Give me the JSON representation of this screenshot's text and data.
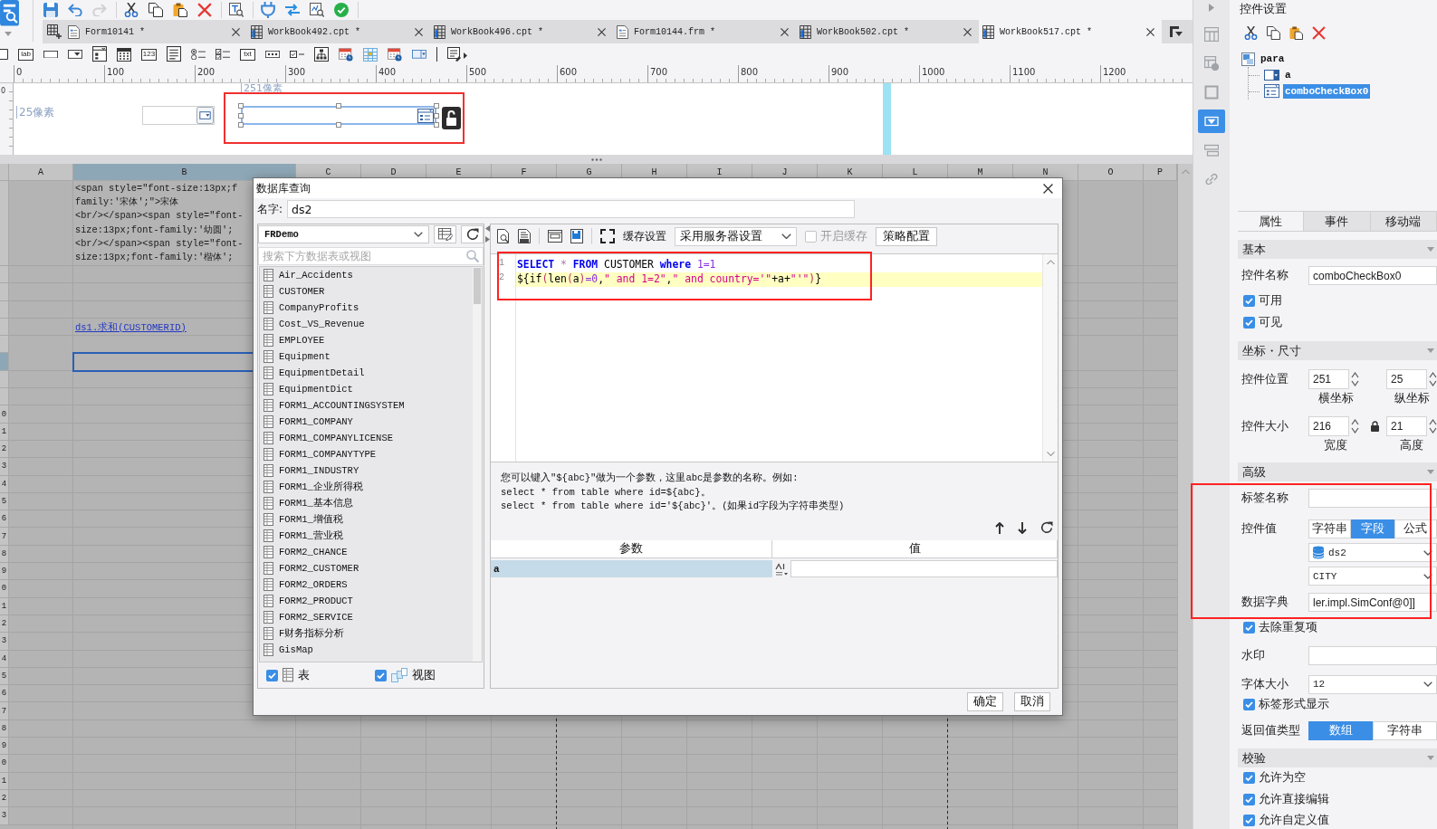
{
  "toolbar": {
    "groups": [
      [
        {
          "kind": "save",
          "disabled": false
        },
        {
          "kind": "undo",
          "disabled": false
        },
        {
          "kind": "redo",
          "disabled": true
        }
      ],
      [
        {
          "kind": "cut",
          "disabled": false
        },
        {
          "kind": "copy",
          "disabled": false
        },
        {
          "kind": "paste",
          "disabled": false
        },
        {
          "kind": "delete",
          "disabled": false
        }
      ],
      [
        {
          "kind": "find",
          "disabled": false
        }
      ],
      [
        {
          "kind": "connect",
          "disabled": false
        },
        {
          "kind": "swap",
          "disabled": false
        },
        {
          "kind": "inspect",
          "disabled": false
        },
        {
          "kind": "verify",
          "disabled": false
        }
      ]
    ]
  },
  "doc_tabs": [
    {
      "kind": "form",
      "label": "Form10141 *",
      "selected": false
    },
    {
      "kind": "workbook",
      "label": "WorkBook492.cpt *",
      "selected": false
    },
    {
      "kind": "workbook",
      "label": "WorkBook496.cpt *",
      "selected": false
    },
    {
      "kind": "form",
      "label": "Form10144.frm *",
      "selected": false
    },
    {
      "kind": "workbook",
      "label": "WorkBook502.cpt *",
      "selected": false
    },
    {
      "kind": "workbook",
      "label": "WorkBook517.cpt *",
      "selected": true
    }
  ],
  "widget_bar": [
    {
      "kind": "frame"
    },
    {
      "kind": "label",
      "caption": "lab"
    },
    {
      "kind": "button"
    },
    {
      "kind": "combo"
    },
    {
      "kind": "window"
    },
    {
      "kind": "calendar"
    },
    {
      "kind": "number",
      "caption": "123"
    },
    {
      "kind": "textarea"
    },
    {
      "kind": "radio"
    },
    {
      "kind": "checklist"
    },
    {
      "kind": "textbox",
      "caption": "txt"
    },
    {
      "kind": "password"
    },
    {
      "kind": "checkbox"
    },
    {
      "kind": "tree"
    },
    {
      "kind": "date"
    },
    {
      "kind": "grid"
    },
    {
      "kind": "date"
    },
    {
      "kind": "combocheck"
    },
    {
      "kind": "divider"
    },
    {
      "kind": "more"
    }
  ],
  "ruler": {
    "labels": [
      "0",
      "100",
      "200",
      "300",
      "400",
      "500",
      "600",
      "700",
      "800",
      "900",
      "1000",
      "1100",
      "1200"
    ],
    "side_label": "0"
  },
  "designer": {
    "left_guide": "25像素",
    "top_guide": "251像素",
    "selection_locked": false,
    "widgets": [
      {
        "kind": "combo",
        "selected": false,
        "highlighted": false
      },
      {
        "kind": "combocheck",
        "selected": true,
        "highlighted": true
      }
    ]
  },
  "sheet": {
    "columns": [
      {
        "label": "A",
        "selected": false,
        "page_break": false
      },
      {
        "label": "B",
        "selected": true,
        "page_break": false
      },
      {
        "label": "C",
        "selected": false,
        "page_break": false
      },
      {
        "label": "D",
        "selected": false,
        "page_break": false
      },
      {
        "label": "E",
        "selected": false,
        "page_break": false
      },
      {
        "label": "F",
        "selected": false,
        "page_break": true
      },
      {
        "label": "G",
        "selected": false,
        "page_break": false
      },
      {
        "label": "H",
        "selected": false,
        "page_break": false
      },
      {
        "label": "I",
        "selected": false,
        "page_break": false
      },
      {
        "label": "J",
        "selected": false,
        "page_break": false
      },
      {
        "label": "K",
        "selected": false,
        "page_break": false
      },
      {
        "label": "L",
        "selected": false,
        "page_break": true
      },
      {
        "label": "M",
        "selected": false,
        "page_break": false
      },
      {
        "label": "N",
        "selected": false,
        "page_break": false
      },
      {
        "label": "O",
        "selected": false,
        "page_break": false
      },
      {
        "label": "P",
        "selected": false,
        "page_break": false
      }
    ],
    "rows": [
      {
        "selected": false,
        "column_b": {
          "kind": "text",
          "lines": [
            "<span style=\"font-size:13px;f",
            "family:'宋体';\">宋体",
            "<br/></span><span style=\"font-",
            "size:13px;font-family:'幼圆';",
            "<br/></span><span style=\"font-",
            "size:13px;font-family:'楷体';"
          ]
        }
      },
      {
        "selected": false
      },
      {
        "selected": false
      },
      {
        "selected": false
      },
      {
        "selected": false,
        "column_b": {
          "kind": "link",
          "text": "ds1.求和(CUSTOMERID)"
        }
      },
      {
        "selected": false
      },
      {
        "selected": true
      },
      {
        "selected": false
      },
      {
        "selected": false
      },
      {
        "selected": false,
        "number": "0"
      },
      {
        "selected": false,
        "number": "1"
      },
      {
        "selected": false,
        "number": "2"
      },
      {
        "selected": false,
        "number": "3"
      },
      {
        "selected": false,
        "number": "4"
      },
      {
        "selected": false,
        "number": "5"
      },
      {
        "selected": false,
        "number": "6"
      },
      {
        "selected": false,
        "number": "7"
      },
      {
        "selected": false,
        "number": "8"
      },
      {
        "selected": false,
        "number": "9"
      },
      {
        "selected": false,
        "number": "0"
      },
      {
        "selected": false,
        "number": "1"
      },
      {
        "selected": false,
        "number": "2"
      },
      {
        "selected": false,
        "number": "3"
      },
      {
        "selected": false,
        "number": "4"
      },
      {
        "selected": false,
        "number": "5"
      },
      {
        "selected": false,
        "number": "6"
      },
      {
        "selected": false,
        "number": "7"
      },
      {
        "selected": false,
        "number": "8"
      },
      {
        "selected": false,
        "number": "9"
      },
      {
        "selected": false,
        "number": "0"
      },
      {
        "selected": false,
        "number": "1"
      },
      {
        "selected": false,
        "number": "2"
      },
      {
        "selected": false,
        "number": "3"
      }
    ]
  },
  "dialog": {
    "title": "数据库查询",
    "name_label": "名字:",
    "name_value": "ds2",
    "datasource": "FRDemo",
    "search_placeholder": "搜索下方数据表或视图",
    "tables": [
      {
        "label": "Air_Accidents",
        "selected": false
      },
      {
        "label": "CUSTOMER",
        "selected": false
      },
      {
        "label": "CompanyProfits",
        "selected": false
      },
      {
        "label": "Cost_VS_Revenue",
        "selected": false
      },
      {
        "label": "EMPLOYEE",
        "selected": false
      },
      {
        "label": "Equipment",
        "selected": false
      },
      {
        "label": "EquipmentDetail",
        "selected": false
      },
      {
        "label": "EquipmentDict",
        "selected": false
      },
      {
        "label": "FORM1_ACCOUNTINGSYSTEM",
        "selected": false
      },
      {
        "label": "FORM1_COMPANY",
        "selected": false
      },
      {
        "label": "FORM1_COMPANYLICENSE",
        "selected": false
      },
      {
        "label": "FORM1_COMPANYTYPE",
        "selected": false
      },
      {
        "label": "FORM1_INDUSTRY",
        "selected": false
      },
      {
        "label": "FORM1_企业所得税",
        "selected": false
      },
      {
        "label": "FORM1_基本信息",
        "selected": false
      },
      {
        "label": "FORM1_增值税",
        "selected": false
      },
      {
        "label": "FORM1_营业税",
        "selected": false
      },
      {
        "label": "FORM2_CHANCE",
        "selected": false
      },
      {
        "label": "FORM2_CUSTOMER",
        "selected": false
      },
      {
        "label": "FORM2_ORDERS",
        "selected": false
      },
      {
        "label": "FORM2_PRODUCT",
        "selected": false
      },
      {
        "label": "FORM2_SERVICE",
        "selected": false
      },
      {
        "label": "F财务指标分析",
        "selected": false
      },
      {
        "label": "GisMap",
        "selected": false
      }
    ],
    "filters": [
      {
        "kind": "table",
        "label": "表",
        "checked": true
      },
      {
        "kind": "view",
        "label": "视图",
        "checked": true
      }
    ],
    "toolbar": {
      "cache_label": "缓存设置",
      "cache_mode": "采用服务器设置",
      "enable_cache": {
        "label": "开启缓存",
        "checked": false,
        "disabled": true
      },
      "strategy": "策略配置"
    },
    "sql": {
      "highlighted": true,
      "lines": [
        {
          "number": "1",
          "current": false,
          "tokens": [
            {
              "kind": "keyword",
              "text": "SELECT "
            },
            {
              "kind": "operator",
              "text": "* "
            },
            {
              "kind": "keyword",
              "text": "FROM"
            },
            {
              "kind": "plain",
              "text": " CUSTOMER "
            },
            {
              "kind": "keyword",
              "text": "where "
            },
            {
              "kind": "number",
              "text": "1=1"
            }
          ]
        },
        {
          "number": "2",
          "current": true,
          "tokens": [
            {
              "kind": "plain",
              "text": "${if"
            },
            {
              "kind": "paren",
              "text": "("
            },
            {
              "kind": "plain",
              "text": "len"
            },
            {
              "kind": "paren",
              "text": "("
            },
            {
              "kind": "plain",
              "text": "a"
            },
            {
              "kind": "paren",
              "text": ")"
            },
            {
              "kind": "number",
              "text": "=0"
            },
            {
              "kind": "plain",
              "text": ","
            },
            {
              "kind": "string",
              "text": "\" and 1=2\""
            },
            {
              "kind": "plain",
              "text": ","
            },
            {
              "kind": "string",
              "text": "\" and country='\""
            },
            {
              "kind": "plain",
              "text": "+a+"
            },
            {
              "kind": "string",
              "text": "\"'\""
            },
            {
              "kind": "paren",
              "text": ")"
            },
            {
              "kind": "plain",
              "text": "}"
            }
          ]
        }
      ]
    },
    "hint": [
      "您可以键入\"${abc}\"做为一个参数，这里abc是参数的名称。例如:",
      "select * from table where id=${abc}。",
      "select * from table where id='${abc}'。(如果id字段为字符串类型)"
    ],
    "params": {
      "columns": [
        "参数",
        "值"
      ],
      "rows": [
        {
          "name": "a",
          "selected": true
        }
      ]
    },
    "buttons": [
      "确定",
      "取消"
    ]
  },
  "side_strip": [
    {
      "kind": "layout",
      "selected": false
    },
    {
      "kind": "params",
      "selected": false
    },
    {
      "kind": "frame",
      "selected": false
    },
    {
      "kind": "widget",
      "selected": true
    },
    {
      "kind": "stack",
      "selected": false
    },
    {
      "kind": "link",
      "selected": false
    }
  ],
  "properties": {
    "title": "控件设置",
    "tools": [
      {
        "kind": "cut"
      },
      {
        "kind": "copy"
      },
      {
        "kind": "paste"
      },
      {
        "kind": "delete"
      }
    ],
    "tree": {
      "kind": "layout",
      "label": "para",
      "selected": false,
      "children": [
        {
          "kind": "combo",
          "label": "a",
          "selected": false
        },
        {
          "kind": "combocheck",
          "label": "comboCheckBox0",
          "selected": true
        }
      ]
    },
    "tabs": [
      {
        "label": "属性",
        "selected": true
      },
      {
        "label": "事件",
        "selected": false
      },
      {
        "label": "移动端",
        "selected": false
      }
    ],
    "sections": [
      {
        "title": "基本",
        "expanded": true,
        "rows": [
          {
            "kind": "text",
            "label": "控件名称",
            "value": "comboCheckBox0"
          },
          {
            "kind": "checkbox",
            "label": "可用",
            "checked": true
          },
          {
            "kind": "checkbox",
            "label": "可见",
            "checked": true
          }
        ]
      },
      {
        "title": "坐标・尺寸",
        "expanded": true,
        "rows": [
          {
            "kind": "spinners",
            "label": "控件位置",
            "fields": [
              {
                "value": "251",
                "caption": "横坐标"
              },
              {
                "value": "25",
                "caption": "纵坐标"
              }
            ]
          },
          {
            "kind": "lockpair",
            "label": "控件大小",
            "fields": [
              {
                "value": "216",
                "caption": "宽度"
              },
              {
                "value": "21",
                "caption": "高度"
              }
            ]
          }
        ]
      },
      {
        "title": "高级",
        "expanded": true,
        "rows": [
          {
            "kind": "group",
            "highlighted": true,
            "rows": [
              {
                "kind": "text",
                "label": "标签名称"
              },
              {
                "kind": "segmented",
                "label": "控件值",
                "options": [
                  {
                    "label": "字符串",
                    "selected": false
                  },
                  {
                    "label": "字段",
                    "selected": true
                  },
                  {
                    "label": "公式",
                    "selected": false
                  }
                ]
              },
              {
                "kind": "dataset",
                "value": "ds2"
              },
              {
                "kind": "select",
                "value": "CITY"
              },
              {
                "kind": "text",
                "label": "数据字典",
                "value": "ler.impl.SimConf@0]]"
              }
            ]
          },
          {
            "kind": "checkbox",
            "label": "去除重复项",
            "checked": true
          },
          {
            "kind": "text",
            "label": "水印"
          },
          {
            "kind": "select",
            "label": "字体大小",
            "value": "12"
          },
          {
            "kind": "checkbox",
            "label": "标签形式显示",
            "checked": true
          },
          {
            "kind": "segmented",
            "label": "返回值类型",
            "options": [
              {
                "label": "数组",
                "selected": true
              },
              {
                "label": "字符串",
                "selected": false
              }
            ]
          }
        ]
      },
      {
        "title": "校验",
        "expanded": true,
        "rows": [
          {
            "kind": "checkbox",
            "label": "允许为空",
            "checked": true
          },
          {
            "kind": "checkbox",
            "label": "允许直接编辑",
            "checked": true
          },
          {
            "kind": "checkbox",
            "label": "允许自定义值",
            "checked": true
          }
        ]
      }
    ]
  }
}
